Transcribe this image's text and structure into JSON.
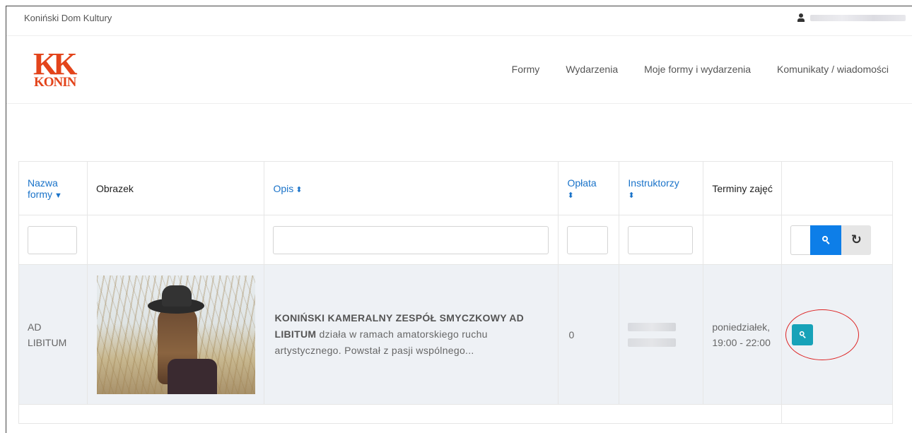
{
  "topbar": {
    "site_name": "Koniński Dom Kultury"
  },
  "logo": {
    "line1": "KK",
    "line2": "KONIN"
  },
  "nav": [
    {
      "label": "Formy"
    },
    {
      "label": "Wydarzenia"
    },
    {
      "label": "Moje formy i wydarzenia"
    },
    {
      "label": "Komunikaty / wiadomości"
    }
  ],
  "table": {
    "headers": {
      "name": "Nazwa formy",
      "image": "Obrazek",
      "desc": "Opis",
      "fee": "Opłata",
      "instructors": "Instruktorzy",
      "terms": "Terminy zajęć"
    },
    "rows": [
      {
        "name": "AD LIBITUM",
        "desc_bold": "KONIŃSKI KAMERALNY ZESPÓŁ SMYCZKOWY AD LIBITUM",
        "desc_rest": " działa w ramach amatorskiego ruchu artystycznego. Powstał z pasji wspólnego...",
        "fee": "0",
        "terms": "poniedziałek, 19:00 - 22:00"
      }
    ]
  },
  "icons": {
    "user": "user-icon",
    "search": "search-icon",
    "reset": "reset-icon",
    "view": "zoom-icon"
  },
  "colors": {
    "brand": "#e3441b",
    "link": "#1a73c9",
    "search_button": "#0d7ee8",
    "view_button": "#17a2b8",
    "annotation": "#dd2222"
  }
}
